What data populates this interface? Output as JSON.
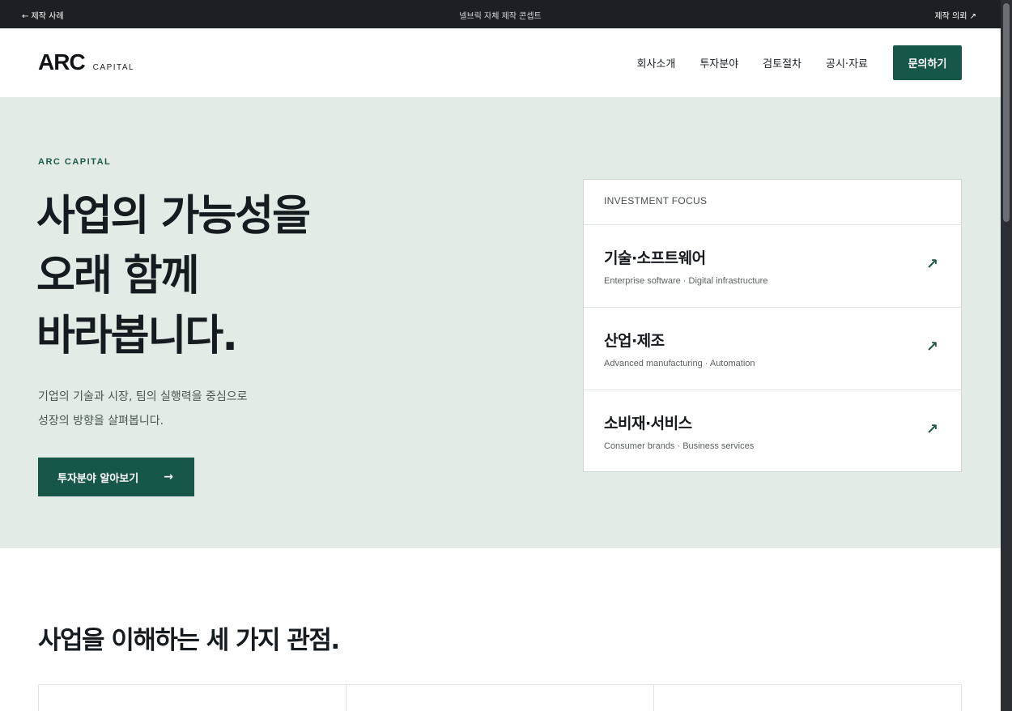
{
  "topbar": {
    "left": "← 제작 사례",
    "center": "넬브릭 자체 제작 콘셉트",
    "right": "제작 의뢰 ↗"
  },
  "nav": {
    "logo_main": "ARC",
    "logo_sub": "CAPITAL",
    "menu": [
      "회사소개",
      "투자분야",
      "검토절차",
      "공시·자료"
    ],
    "cta": "문의하기"
  },
  "hero": {
    "eyebrow": "ARC CAPITAL",
    "headline": [
      "사업의 가능성을",
      "오래 함께",
      "바라봅니다."
    ],
    "desc": [
      "기업의 기술과 시장, 팀의 실행력을 중심으로",
      "성장의 방향을 살펴봅니다."
    ],
    "button": "투자분야 알아보기",
    "button_arrow": "→"
  },
  "focus": {
    "head": "INVESTMENT FOCUS",
    "items": [
      {
        "title": "기술·소프트웨어",
        "sub": "Enterprise software · Digital infrastructure",
        "arrow": "↗"
      },
      {
        "title": "산업·제조",
        "sub": "Advanced manufacturing · Automation",
        "arrow": "↗"
      },
      {
        "title": "소비재·서비스",
        "sub": "Consumer brands · Business services",
        "arrow": "↗"
      }
    ]
  },
  "section": {
    "title": "사업을 이해하는 세 가지 관점."
  },
  "colors": {
    "accent": "#17574a",
    "hero_bg": "#e2ebe6",
    "topbar_bg": "#1c1f24"
  }
}
